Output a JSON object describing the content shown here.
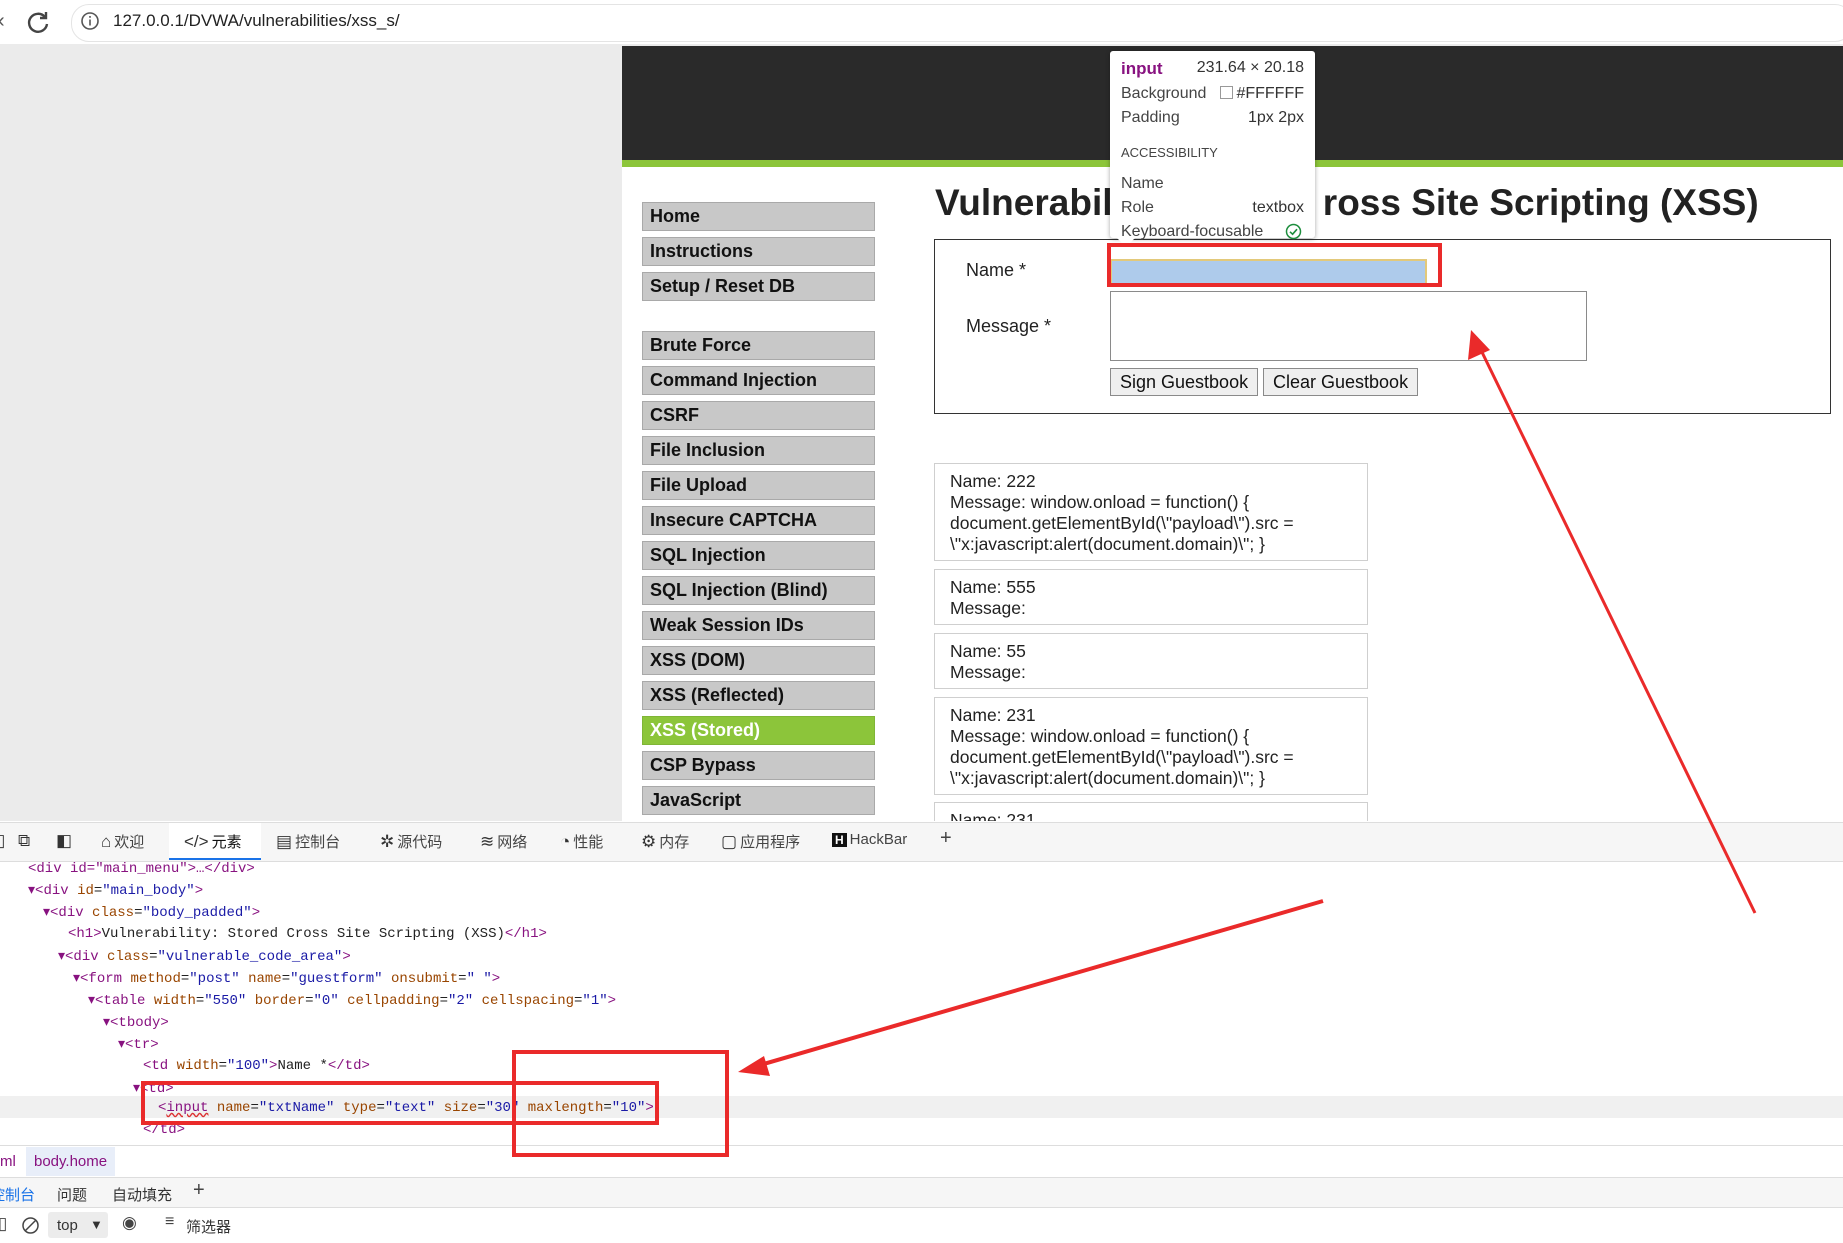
{
  "browser": {
    "url": "127.0.0.1/DVWA/vulnerabilities/xss_s/"
  },
  "dvwa": {
    "menu_group1": [
      "Home",
      "Instructions",
      "Setup / Reset DB"
    ],
    "menu_group2": [
      "Brute Force",
      "Command Injection",
      "CSRF",
      "File Inclusion",
      "File Upload",
      "Insecure CAPTCHA",
      "SQL Injection",
      "SQL Injection (Blind)",
      "Weak Session IDs",
      "XSS (DOM)",
      "XSS (Reflected)",
      "XSS (Stored)",
      "CSP Bypass",
      "JavaScript"
    ],
    "active_item": "XSS (Stored)",
    "title_left": "Vulnerabili",
    "title_right": "ross Site Scripting (XSS)",
    "form": {
      "name_label": "Name *",
      "message_label": "Message *",
      "sign_button": "Sign Guestbook",
      "clear_button": "Clear Guestbook"
    },
    "entries": [
      {
        "name": "Name: 222",
        "lines": [
          "Message: window.onload = function() {",
          "document.getElementById(\\\"payload\\\").src =",
          "\\\"x:javascript:alert(document.domain)\\\"; }"
        ]
      },
      {
        "name": "Name: 555",
        "lines": [
          "Message:"
        ]
      },
      {
        "name": "Name: 55",
        "lines": [
          "Message:"
        ]
      },
      {
        "name": "Name: 231",
        "lines": [
          "Message: window.onload = function() {",
          "document.getElementById(\\\"payload\\\").src =",
          "\\\"x:javascript:alert(document.domain)\\\"; }"
        ]
      },
      {
        "name": "Name: 231",
        "lines": []
      }
    ]
  },
  "tooltip": {
    "tag": "input",
    "size": "231.64 × 20.18",
    "background_label": "Background",
    "background_value": "#FFFFFF",
    "padding_label": "Padding",
    "padding_value": "1px 2px",
    "section": "ACCESSIBILITY",
    "name_label": "Name",
    "role_label": "Role",
    "role_value": "textbox",
    "focus_label": "Keyboard-focusable"
  },
  "devtools": {
    "tabs": [
      "欢迎",
      "元素",
      "控制台",
      "源代码",
      "网络",
      "性能",
      "内存",
      "应用程序",
      "HackBar"
    ],
    "dom": {
      "l0": "<div id=\"main_menu\">…</div>",
      "main_body_tag": "div",
      "main_body_attr": "id",
      "main_body_val": "\"main_body\"",
      "body_padded_val": "\"body_padded\"",
      "h1_text": "Vulnerability: Stored Cross Site Scripting (XSS)",
      "vuln_val": "\"vulnerable_code_area\"",
      "form_method": "\"post\"",
      "form_name": "\"guestform\"",
      "form_onsubmit": "\" \"",
      "table_width": "\"550\"",
      "table_border": "\"0\"",
      "table_padding": "\"2\"",
      "table_spacing": "\"1\"",
      "td_width": "\"100\"",
      "td_text": "Name *",
      "input_name": "\"txtName\"",
      "input_type": "\"text\"",
      "input_size": "\"30\"",
      "input_maxlength": "\"10\""
    },
    "breadcrumbs": [
      "ml",
      "body.home"
    ],
    "drawer_tabs": [
      "控制台",
      "问题",
      "自动填充"
    ],
    "console_context": "top",
    "filter_label": "筛选器"
  },
  "colors": {
    "accent_green": "#8cc53a",
    "annotation_red": "#ea2a2a",
    "header_dark": "#2a2a2a"
  }
}
